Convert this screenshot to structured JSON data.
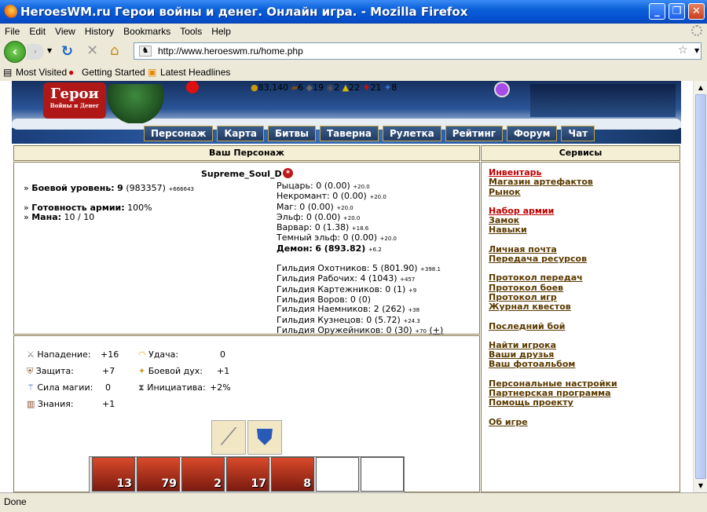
{
  "window": {
    "title": "HeroesWM.ru Герои войны и денег. Онлайн игра. - Mozilla Firefox"
  },
  "menu": [
    "File",
    "Edit",
    "View",
    "History",
    "Bookmarks",
    "Tools",
    "Help"
  ],
  "url": "http://www.heroeswm.ru/home.php",
  "bookmarks": [
    "Most Visited",
    "Getting Started",
    "Latest Headlines"
  ],
  "resources": {
    "gold": "83,140",
    "wood": "6",
    "ore": "19",
    "mercury": "2",
    "sulfur": "22",
    "crystals": "21",
    "gems": "8"
  },
  "logo": {
    "text": "Герои",
    "subtext": "Войны и Денег"
  },
  "nav": [
    "Персонаж",
    "Карта",
    "Битвы",
    "Таверна",
    "Рулетка",
    "Рейтинг",
    "Форум",
    "Чат"
  ],
  "character_panel": {
    "title": "Ваш Персонаж",
    "name": "Supreme_Soul_D",
    "level_label": "Боевой уровень:",
    "level_value": "9",
    "level_exp": "(983357)",
    "level_need": "+666643",
    "army_label": "Готовность армии:",
    "army_value": "100%",
    "mana_label": "Мана:",
    "mana_value": "10 / 10",
    "factions": [
      {
        "label": "Рыцарь:",
        "val": "0 (0.00)",
        "sub": "+20.0"
      },
      {
        "label": "Некромант:",
        "val": "0 (0.00)",
        "sub": "+20.0"
      },
      {
        "label": "Маг:",
        "val": "0 (0.00)",
        "sub": "+20.0"
      },
      {
        "label": "Эльф:",
        "val": "0 (0.00)",
        "sub": "+20.0"
      },
      {
        "label": "Варвар:",
        "val": "0 (1.38)",
        "sub": "+18.6"
      },
      {
        "label": "Темный эльф:",
        "val": "0 (0.00)",
        "sub": "+20.0"
      },
      {
        "label": "Демон:",
        "val": "6 (893.82)",
        "sub": "+6.2"
      }
    ],
    "guilds": [
      {
        "label": "Гильдия Охотников:",
        "val": "5 (801.90)",
        "sub": "+398.1"
      },
      {
        "label": "Гильдия Рабочих:",
        "val": "4 (1043)",
        "sub": "+457"
      },
      {
        "label": "Гильдия Картежников:",
        "val": "0 (1)",
        "sub": "+9"
      },
      {
        "label": "Гильдия Воров:",
        "val": "0 (0)",
        "sub": ""
      },
      {
        "label": "Гильдия Наемников:",
        "val": "2 (262)",
        "sub": "+38"
      },
      {
        "label": "Гильдия Кузнецов:",
        "val": "0 (5.72)",
        "sub": "+24.3"
      },
      {
        "label": "Гильдия Оружейников:",
        "val": "0 (30)",
        "sub": "+70",
        "extra": "(+)"
      }
    ]
  },
  "stats": {
    "attack": {
      "label": "Нападение:",
      "val": "+16"
    },
    "defense": {
      "label": "Защита:",
      "val": "+7"
    },
    "spellpower": {
      "label": "Сила магии:",
      "val": "0"
    },
    "knowledge": {
      "label": "Знания:",
      "val": "+1"
    },
    "luck": {
      "label": "Удача:",
      "val": "0"
    },
    "morale": {
      "label": "Боевой дух:",
      "val": "+1"
    },
    "initiative": {
      "label": "Инициатива:",
      "val": "+2%"
    }
  },
  "army": [
    "13",
    "79",
    "2",
    "17",
    "8",
    "",
    ""
  ],
  "services": {
    "title": "Сервисы",
    "groups": [
      [
        {
          "t": "Инвентарь",
          "red": true
        },
        {
          "t": "Магазин артефактов"
        },
        {
          "t": "Рынок"
        }
      ],
      [
        {
          "t": "Набор армии",
          "red": true
        },
        {
          "t": "Замок"
        },
        {
          "t": "Навыки"
        }
      ],
      [
        {
          "t": "Личная почта"
        },
        {
          "t": "Передача ресурсов"
        }
      ],
      [
        {
          "t": "Протокол передач"
        },
        {
          "t": "Протокол боев"
        },
        {
          "t": "Протокол игр"
        },
        {
          "t": "Журнал квестов"
        }
      ],
      [
        {
          "t": "Последний бой"
        }
      ],
      [
        {
          "t": "Найти игрока"
        },
        {
          "t": "Ваши друзья"
        },
        {
          "t": "Ваш фотоальбом"
        }
      ],
      [
        {
          "t": "Персональные настройки"
        },
        {
          "t": "Партнерская программа"
        },
        {
          "t": "Помощь проекту"
        }
      ],
      [
        {
          "t": "Об игре"
        }
      ]
    ]
  },
  "status": "Done"
}
